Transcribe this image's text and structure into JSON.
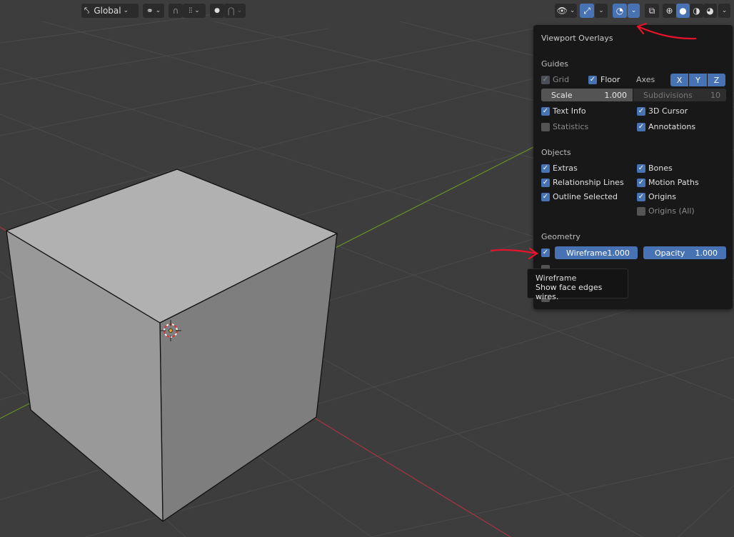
{
  "header": {
    "transform_orientation": "Global"
  },
  "overlays_panel": {
    "title": "Viewport Overlays",
    "guides": {
      "section_label": "Guides",
      "grid_label": "Grid",
      "floor_label": "Floor",
      "axes_label": "Axes",
      "axis_x": "X",
      "axis_y": "Y",
      "axis_z": "Z",
      "scale_label": "Scale",
      "scale_value": "1.000",
      "subdivisions_label": "Subdivisions",
      "subdivisions_value": "10",
      "text_info_label": "Text Info",
      "cursor_3d_label": "3D Cursor",
      "statistics_label": "Statistics",
      "annotations_label": "Annotations"
    },
    "objects": {
      "section_label": "Objects",
      "extras_label": "Extras",
      "bones_label": "Bones",
      "relationship_lines_label": "Relationship Lines",
      "motion_paths_label": "Motion Paths",
      "outline_selected_label": "Outline Selected",
      "origins_label": "Origins",
      "origins_all_label": "Origins (All)"
    },
    "geometry": {
      "section_label": "Geometry",
      "wireframe_label": "Wireframe",
      "wireframe_value": "1.000",
      "opacity_label": "Opacity",
      "opacity_value": "1.000"
    }
  },
  "tooltip": {
    "title": "Wireframe",
    "description": "Show face edges wires."
  },
  "colors": {
    "accent": "#4772b3",
    "viewport_bg": "#3d3d3d",
    "panel_bg": "#181818",
    "annotation_red": "#e8132a",
    "axis_x_line": "#a8353f",
    "axis_y_line": "#6a8f2a"
  }
}
